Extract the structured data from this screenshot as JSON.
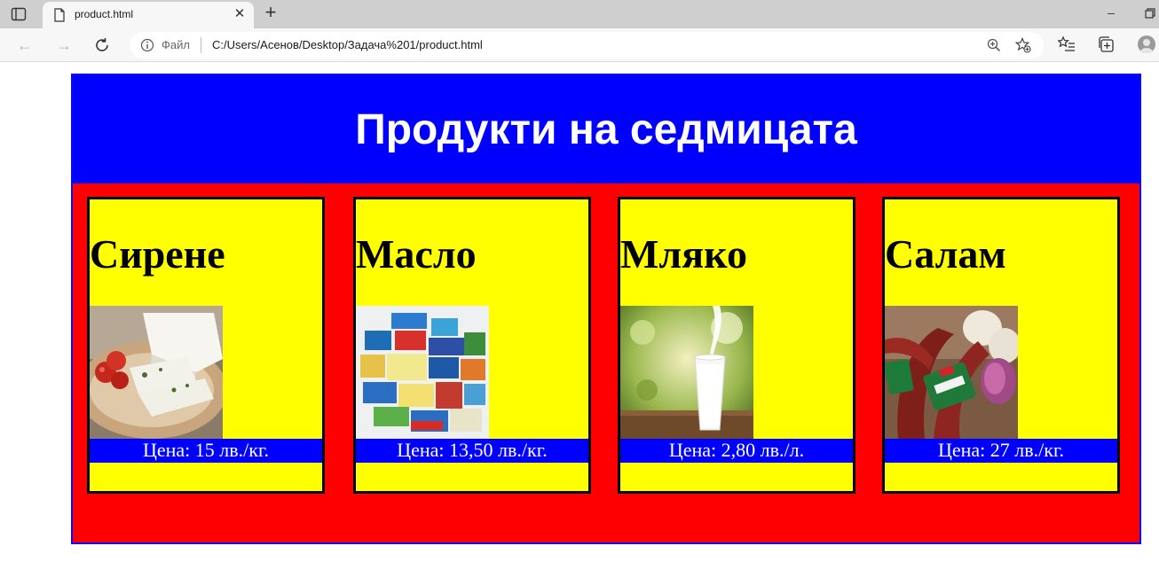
{
  "browser": {
    "tab_title": "product.html",
    "address_scheme": "Файл",
    "address_url": "C:/Users/Асенов/Desktop/Задача%201/product.html"
  },
  "page": {
    "title": "Продукти на седмицата",
    "products": [
      {
        "name": "Сирене",
        "price": "Цена: 15 лв./кг.",
        "image": "cheese-photo"
      },
      {
        "name": "Масло",
        "price": "Цена: 13,50 лв./кг.",
        "image": "butter-photo"
      },
      {
        "name": "Мляко",
        "price": "Цена: 2,80 лв./л.",
        "image": "milk-photo"
      },
      {
        "name": "Салам",
        "price": "Цена: 27 лв./кг.",
        "image": "salami-photo"
      }
    ]
  },
  "colors": {
    "header_bg": "#0000ff",
    "container_bg": "#ff0000",
    "card_bg": "#ffff00",
    "price_bg": "#0000ff"
  }
}
